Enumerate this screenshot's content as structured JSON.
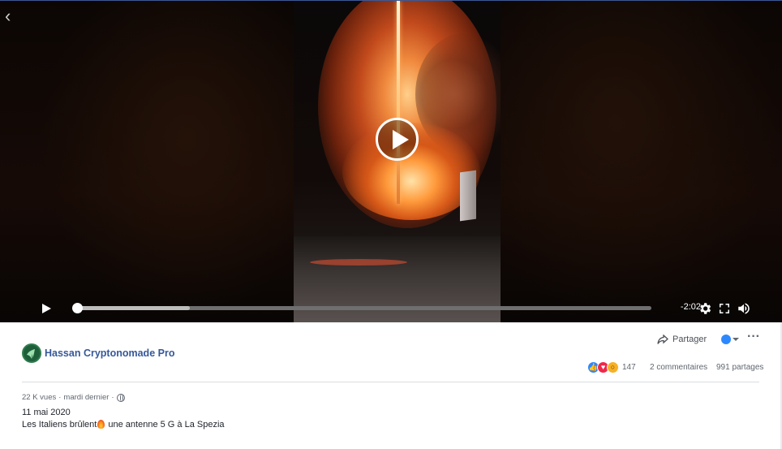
{
  "player": {
    "time_remaining": "-2:02",
    "progress_played": 0.0,
    "progress_buffered": 0.2
  },
  "post": {
    "page_name": "Hassan Cryptonomade Pro",
    "share_label": "Partager",
    "reactions_count": "147",
    "comments_label": "2 commentaires",
    "shares_label": "991 partages",
    "views": "22 K vues",
    "separator": "·",
    "posted_when": "mardi dernier",
    "date": "11 mai 2020",
    "text_before": "Les Italiens brûlent",
    "text_after": " une antenne 5 G à La Spezia"
  },
  "colors": {
    "link_blue": "#365899",
    "like_blue": "#2d88ff",
    "love_red": "#f0284a",
    "wow_yellow": "#f7b125"
  },
  "icons": {
    "back": "chevron-left-icon",
    "play": "play-icon",
    "settings": "gear-icon",
    "fullscreen": "fullscreen-icon",
    "volume": "volume-icon",
    "share": "share-arrow-icon",
    "more": "more-dots-icon",
    "privacy": "globe-icon",
    "emoji": "fire-emoji"
  }
}
